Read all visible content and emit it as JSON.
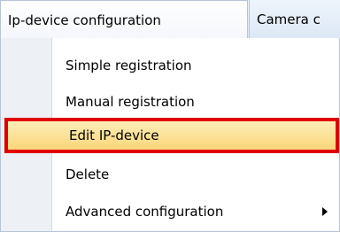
{
  "menubar": {
    "active_menu": "Ip-device configuration",
    "next_menu": "Camera c"
  },
  "dropdown": {
    "items": [
      {
        "label": "Simple registration"
      },
      {
        "label": "Manual registration"
      },
      {
        "label": "Edit IP-device",
        "highlighted": true
      },
      {
        "label": "Delete"
      },
      {
        "label": "Advanced configuration",
        "has_submenu": true
      }
    ],
    "highlight_color": "#fbd67a",
    "highlight_outline_color": "#e00000"
  }
}
